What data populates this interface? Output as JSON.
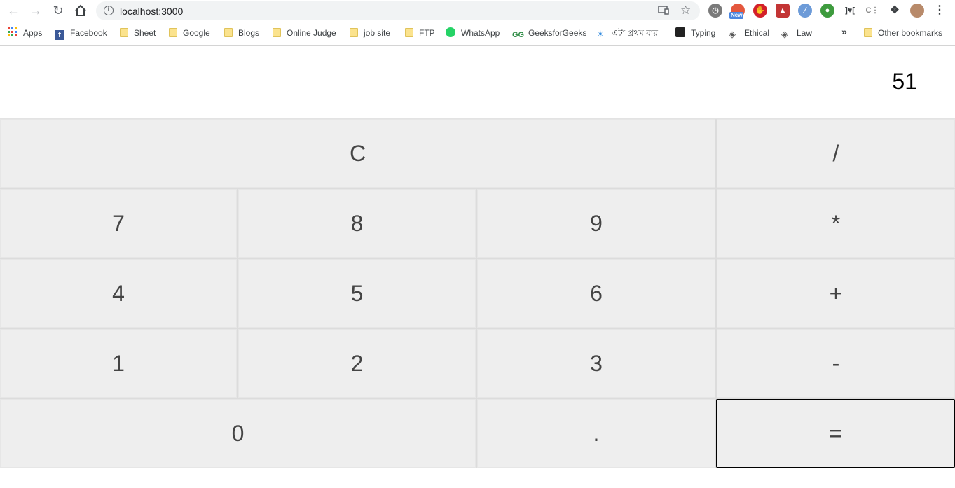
{
  "browser": {
    "url": "localhost:3000",
    "extension_badge": "New",
    "bookmarks": [
      {
        "label": "Apps",
        "icon": "apps-grid-icon"
      },
      {
        "label": "Facebook",
        "icon": "facebook-icon"
      },
      {
        "label": "Sheet",
        "icon": "folder-icon"
      },
      {
        "label": "Google",
        "icon": "folder-icon"
      },
      {
        "label": "Blogs",
        "icon": "folder-icon"
      },
      {
        "label": "Online Judge",
        "icon": "folder-icon"
      },
      {
        "label": "job site",
        "icon": "folder-icon"
      },
      {
        "label": "FTP",
        "icon": "folder-icon"
      },
      {
        "label": "WhatsApp",
        "icon": "whatsapp-icon"
      },
      {
        "label": "GeeksforGeeks",
        "icon": "geeksforgeeks-icon"
      },
      {
        "label": "এটা প্রথম বার",
        "icon": "bulb-icon"
      },
      {
        "label": "Typing",
        "icon": "typing-icon"
      },
      {
        "label": "Ethical",
        "icon": "diamond-icon"
      },
      {
        "label": "Law",
        "icon": "diamond-icon"
      }
    ],
    "overflow_label": "»",
    "other_bookmarks": "Other bookmarks"
  },
  "calculator": {
    "display": "51",
    "keys": {
      "clear": "C",
      "divide": "/",
      "seven": "7",
      "eight": "8",
      "nine": "9",
      "multiply": "*",
      "four": "4",
      "five": "5",
      "six": "6",
      "plus": "+",
      "one": "1",
      "two": "2",
      "three": "3",
      "minus": "-",
      "zero": "0",
      "dot": ".",
      "equals": "="
    }
  },
  "colors": {
    "key_background": "#eeeeee",
    "key_text": "#444444",
    "grid_gap": "#dcdcdc"
  }
}
